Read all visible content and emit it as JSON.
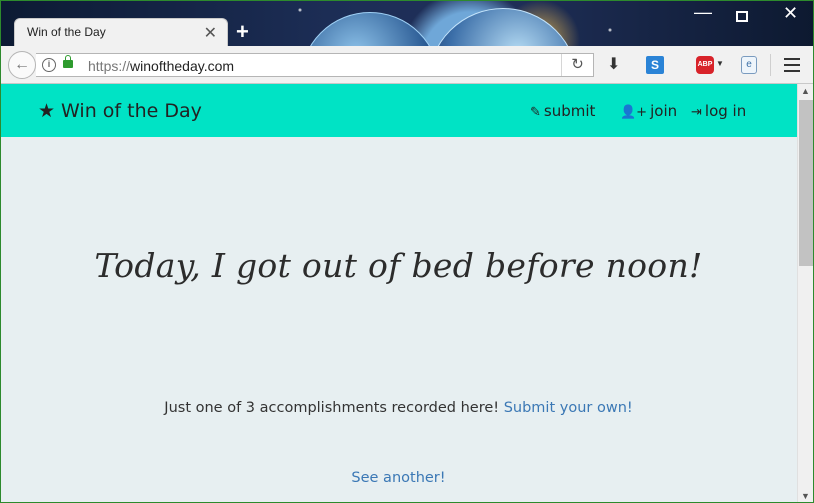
{
  "browser": {
    "tab_title": "Win of the Day",
    "tab_close": "✕",
    "new_tab": "+",
    "url_scheme": "https://",
    "url_host": "winoftheday.com",
    "window_controls": {
      "minimize": "—",
      "close": "✕"
    },
    "icons": {
      "back": "←",
      "reload": "↻",
      "download": "⬇",
      "extension_s": "S",
      "adblock": "ABP",
      "adblock_caret": "▼",
      "extension_e": "e"
    }
  },
  "site": {
    "brand": "Win of the Day",
    "brand_icon": "★",
    "nav": [
      {
        "label": "submit",
        "icon": "✎"
      },
      {
        "label": "join",
        "icon": "👤+"
      },
      {
        "label": "log in",
        "icon": "⇥"
      }
    ]
  },
  "main": {
    "headline": "Today, I got out of bed before noon!",
    "count_text": "Just one of 3 accomplishments recorded here!",
    "submit_link": "Submit your own!",
    "see_another": "See another!"
  },
  "scrollbar": {
    "up": "▲",
    "down": "▼"
  },
  "colors": {
    "navbar": "#00e3c5",
    "page_bg": "#e7eff1",
    "link": "#3b78b5"
  }
}
